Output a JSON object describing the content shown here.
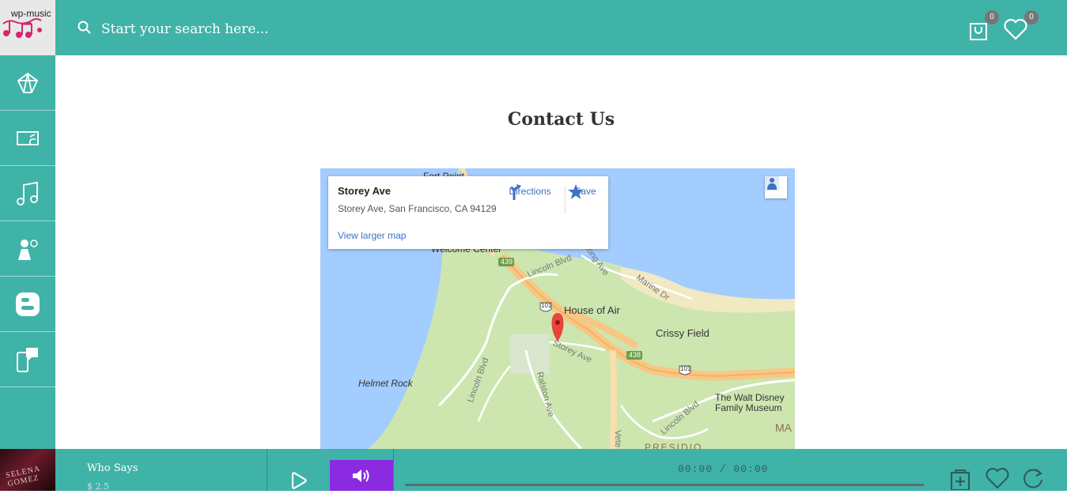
{
  "app": {
    "logo_text": "wp-music"
  },
  "header": {
    "search_placeholder": "Start your search here...",
    "cart_count": "0",
    "wishlist_count": "0"
  },
  "sidebar": {
    "items": [
      {
        "icon": "diamond-icon"
      },
      {
        "icon": "ticket-icon"
      },
      {
        "icon": "music-note-icon"
      },
      {
        "icon": "singer-icon"
      },
      {
        "icon": "blogger-icon"
      },
      {
        "icon": "mobile-chat-icon"
      }
    ]
  },
  "main": {
    "title": "Contact Us"
  },
  "map": {
    "place_name": "Storey Ave",
    "address": "Storey Ave, San Francisco, CA 94129",
    "directions_label": "Directions",
    "save_label": "Save",
    "larger_map_label": "View larger map",
    "labels": {
      "fort_point": "Fort Point",
      "welcome_center": "Welcome Center",
      "house_of_air": "House of Air",
      "crissy_field": "Crissy Field",
      "helmet_rock": "Helmet Rock",
      "walt_disney": "The Walt Disney",
      "family_museum": "Family Museum",
      "presidio": "PRESIDIO",
      "ma": "MA",
      "lincoln_blvd": "Lincoln Blvd",
      "long_ave": "Long Ave",
      "marine_dr": "Marine Dr",
      "storey_ave": "Storey Ave",
      "ralston_ave": "Ralston Ave",
      "lincoln_blvd_2": "Lincoln Blvd",
      "lincoln_blvd_3": "Lincoln Blvd",
      "vete": "Vete",
      "route_439": "439",
      "route_438": "438",
      "route_101a": "101",
      "route_101b": "101"
    }
  },
  "player": {
    "track_title": "Who Says",
    "track_sub": "$ 2.5",
    "album_text": "SELENA GOMEZ",
    "time": "00:00 / 00:00",
    "progress": 0
  },
  "colors": {
    "accent": "#40b3a8",
    "volume": "#8a2be2",
    "link": "#3a72c4"
  }
}
